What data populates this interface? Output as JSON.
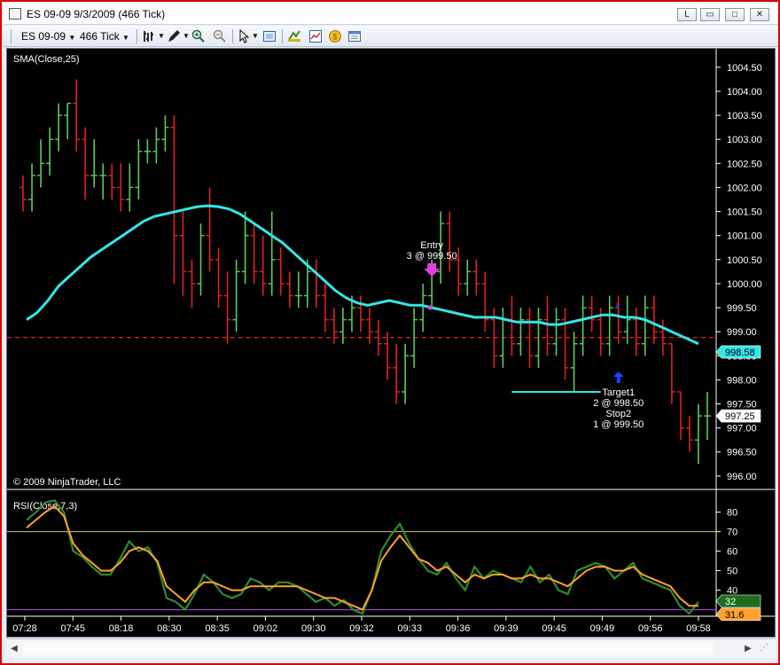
{
  "window": {
    "title": "ES 09-09  9/3/2009 (466 Tick)",
    "buttons": [
      "L",
      "▭",
      "□",
      "✕"
    ]
  },
  "toolbar": {
    "instrument": "ES 09-09",
    "interval": "466 Tick",
    "icons": [
      "bar-style-icon",
      "draw-pencil-icon",
      "zoom-in-icon",
      "zoom-out-icon",
      "cursor-icon",
      "properties-icon",
      "strategy-icon",
      "indicator-icon",
      "coin-icon",
      "data-box-icon"
    ]
  },
  "colors": {
    "background": "#000000",
    "up_bar": "#5ec95e",
    "down_bar": "#e02020",
    "sma": "#34e6e6",
    "rsi_main": "#2e8b2e",
    "rsi_avg": "#ffa12a",
    "price_line": "#e02020",
    "upper_band": "#c8c880",
    "lower_band": "#9040c0"
  },
  "chart_data": {
    "type": "candlestick",
    "instrument": "ES 09-09",
    "indicator_label": "SMA(Close,25)",
    "copyright": "© 2009 NinjaTrader, LLC",
    "price_ticks": [
      "1004.50",
      "1004.00",
      "1003.50",
      "1003.00",
      "1002.50",
      "1002.00",
      "1001.50",
      "1001.00",
      "1000.50",
      "1000.00",
      "999.50",
      "999.00",
      "998.50",
      "998.00",
      "997.50",
      "997.00",
      "996.50",
      "996.00"
    ],
    "price_ylim": [
      995.85,
      1004.7
    ],
    "time_labels": [
      "07:28",
      "07:45",
      "08:18",
      "08:30",
      "08:35",
      "09:02",
      "09:30",
      "09:32",
      "09:33",
      "09:36",
      "09:39",
      "09:45",
      "09:49",
      "09:56",
      "09:58"
    ],
    "current_price_tag": "997.25",
    "current_price": 997.25,
    "ask_tag": "998.58",
    "ask_price": 998.58,
    "bars": [
      [
        1002.0,
        1002.25,
        1001.5,
        1001.75
      ],
      [
        1001.75,
        1002.5,
        1001.5,
        1002.25
      ],
      [
        1002.25,
        1003.0,
        1002.0,
        1002.5
      ],
      [
        1002.5,
        1003.25,
        1002.25,
        1003.0
      ],
      [
        1003.0,
        1003.75,
        1002.75,
        1003.5
      ],
      [
        1003.5,
        1003.75,
        1003.0,
        1003.75
      ],
      [
        1003.75,
        1004.25,
        1002.75,
        1003.0
      ],
      [
        1003.0,
        1003.25,
        1001.75,
        1002.25
      ],
      [
        1002.25,
        1003.0,
        1002.0,
        1002.25
      ],
      [
        1002.25,
        1002.5,
        1001.75,
        1002.25
      ],
      [
        1002.25,
        1002.5,
        1001.75,
        1002.0
      ],
      [
        1002.0,
        1002.5,
        1001.5,
        1001.75
      ],
      [
        1001.75,
        1002.5,
        1001.5,
        1002.0
      ],
      [
        1002.0,
        1003.0,
        1001.75,
        1002.75
      ],
      [
        1002.75,
        1003.0,
        1002.5,
        1002.75
      ],
      [
        1002.75,
        1003.25,
        1002.5,
        1003.0
      ],
      [
        1003.0,
        1003.5,
        1002.75,
        1003.25
      ],
      [
        1003.25,
        1003.5,
        1000.0,
        1001.0
      ],
      [
        1001.0,
        1001.5,
        999.75,
        1000.25
      ],
      [
        1000.25,
        1000.5,
        999.5,
        1000.0
      ],
      [
        1000.0,
        1001.25,
        999.75,
        1001.0
      ],
      [
        1001.0,
        1002.0,
        1000.25,
        1000.5
      ],
      [
        1000.5,
        1000.75,
        999.5,
        999.75
      ],
      [
        999.75,
        1000.25,
        998.75,
        999.25
      ],
      [
        999.25,
        1000.5,
        999.0,
        1000.25
      ],
      [
        1000.25,
        1001.5,
        1000.0,
        1001.0
      ],
      [
        1001.0,
        1001.25,
        1000.0,
        1000.25
      ],
      [
        1000.25,
        1001.0,
        999.75,
        1000.0
      ],
      [
        1000.0,
        1001.5,
        999.75,
        1000.5
      ],
      [
        1000.5,
        1000.75,
        999.75,
        1000.0
      ],
      [
        1000.0,
        1000.25,
        999.5,
        999.75
      ],
      [
        999.75,
        1000.25,
        999.5,
        999.75
      ],
      [
        999.75,
        1000.5,
        999.5,
        1000.25
      ],
      [
        1000.25,
        1000.5,
        999.5,
        999.75
      ],
      [
        999.75,
        1000.0,
        999.0,
        999.25
      ],
      [
        999.25,
        999.5,
        998.75,
        999.0
      ],
      [
        999.0,
        999.5,
        998.75,
        999.25
      ],
      [
        999.25,
        999.75,
        999.0,
        999.5
      ],
      [
        999.5,
        999.75,
        999.0,
        999.25
      ],
      [
        999.25,
        999.5,
        998.75,
        999.0
      ],
      [
        999.0,
        999.25,
        998.5,
        998.75
      ],
      [
        998.75,
        999.0,
        998.0,
        998.25
      ],
      [
        998.25,
        998.75,
        997.5,
        997.75
      ],
      [
        997.75,
        998.75,
        997.5,
        998.5
      ],
      [
        998.5,
        999.5,
        998.25,
        999.25
      ],
      [
        999.25,
        1000.0,
        999.0,
        999.75
      ],
      [
        999.75,
        1000.5,
        999.5,
        1000.25
      ],
      [
        1000.25,
        1001.5,
        1000.0,
        1001.25
      ],
      [
        1001.25,
        1001.5,
        1000.25,
        1000.5
      ],
      [
        1000.5,
        1000.75,
        999.75,
        1000.0
      ],
      [
        1000.0,
        1000.5,
        999.75,
        1000.25
      ],
      [
        1000.25,
        1000.5,
        999.75,
        1000.0
      ],
      [
        1000.0,
        1000.25,
        999.0,
        999.25
      ],
      [
        999.25,
        999.5,
        998.25,
        998.5
      ],
      [
        998.5,
        999.5,
        998.25,
        999.25
      ],
      [
        999.25,
        999.75,
        998.5,
        998.75
      ],
      [
        998.75,
        999.5,
        998.5,
        999.25
      ],
      [
        999.25,
        999.5,
        998.25,
        998.5
      ],
      [
        998.5,
        999.5,
        998.25,
        999.25
      ],
      [
        999.25,
        999.75,
        998.5,
        998.75
      ],
      [
        998.75,
        999.5,
        998.5,
        999.25
      ],
      [
        999.25,
        999.5,
        998.0,
        998.25
      ],
      [
        998.25,
        999.0,
        997.75,
        998.75
      ],
      [
        998.75,
        999.75,
        998.5,
        999.5
      ],
      [
        999.5,
        999.75,
        999.0,
        999.25
      ],
      [
        999.25,
        999.5,
        998.5,
        998.75
      ],
      [
        998.75,
        999.75,
        998.5,
        999.5
      ],
      [
        999.5,
        999.75,
        998.75,
        999.0
      ],
      [
        999.0,
        999.75,
        998.75,
        999.25
      ],
      [
        999.25,
        999.5,
        998.5,
        998.75
      ],
      [
        998.75,
        999.75,
        998.5,
        999.5
      ],
      [
        999.5,
        999.75,
        998.75,
        999.0
      ],
      [
        999.0,
        999.25,
        998.5,
        998.75
      ],
      [
        998.75,
        998.75,
        997.5,
        997.75
      ],
      [
        997.75,
        997.75,
        996.75,
        997.0
      ],
      [
        997.0,
        997.25,
        996.5,
        996.75
      ],
      [
        996.75,
        997.5,
        996.25,
        997.25
      ],
      [
        997.25,
        997.75,
        996.75,
        997.25
      ]
    ],
    "sma": [
      999.25,
      999.4,
      999.65,
      999.95,
      1000.15,
      1000.35,
      1000.55,
      1000.7,
      1000.85,
      1001.0,
      1001.15,
      1001.3,
      1001.4,
      1001.45,
      1001.5,
      1001.55,
      1001.6,
      1001.62,
      1001.6,
      1001.55,
      1001.45,
      1001.3,
      1001.15,
      1001.0,
      1000.85,
      1000.65,
      1000.45,
      1000.25,
      1000.05,
      999.85,
      999.7,
      999.6,
      999.55,
      999.6,
      999.65,
      999.6,
      999.55,
      999.55,
      999.5,
      999.45,
      999.4,
      999.35,
      999.3,
      999.3,
      999.3,
      999.25,
      999.2,
      999.2,
      999.2,
      999.15,
      999.15,
      999.2,
      999.25,
      999.3,
      999.35,
      999.35,
      999.3,
      999.3,
      999.25,
      999.15,
      999.05,
      998.95,
      998.85,
      998.75
    ],
    "entry_marker": {
      "label": "Entry",
      "detail": "3 @ 999.50",
      "bar": 46,
      "price": 999.5
    },
    "exit_marker": {
      "label1": "Target1",
      "detail1": "2 @ 998.50",
      "label2": "Stop2",
      "detail2": "1 @ 999.50",
      "bar": 67,
      "price": 998.5
    },
    "horizontal_line": {
      "price": 998.88
    },
    "cyan_segment": {
      "from_bar": 55,
      "to_bar": 65,
      "price": 997.75
    },
    "rsi": {
      "label": "RSI(Close,7,3)",
      "ticks": [
        "80",
        "70",
        "60",
        "50",
        "40"
      ],
      "ylim": [
        28,
        88
      ],
      "upper_band": 70,
      "lower_band": 30,
      "current_tag_main": "32",
      "current_tag_avg": "31.6",
      "main": [
        76,
        80,
        85,
        86,
        80,
        60,
        57,
        52,
        48,
        48,
        56,
        65,
        60,
        62,
        54,
        36,
        34,
        30,
        38,
        48,
        44,
        38,
        36,
        38,
        46,
        44,
        40,
        44,
        44,
        42,
        38,
        34,
        36,
        32,
        35,
        30,
        28,
        40,
        60,
        68,
        74,
        64,
        56,
        50,
        48,
        54,
        46,
        40,
        52,
        46,
        50,
        48,
        46,
        44,
        52,
        44,
        48,
        40,
        38,
        50,
        52,
        54,
        52,
        46,
        50,
        54,
        46,
        44,
        42,
        40,
        32,
        28,
        34
      ],
      "avg": [
        72,
        76,
        80,
        83,
        78,
        64,
        58,
        54,
        50,
        50,
        54,
        60,
        62,
        60,
        55,
        42,
        38,
        34,
        40,
        44,
        44,
        42,
        40,
        40,
        42,
        42,
        42,
        42,
        42,
        42,
        40,
        38,
        36,
        36,
        34,
        32,
        30,
        40,
        55,
        62,
        68,
        62,
        56,
        54,
        50,
        52,
        48,
        44,
        48,
        46,
        48,
        48,
        46,
        46,
        48,
        46,
        46,
        44,
        42,
        46,
        50,
        52,
        52,
        50,
        50,
        52,
        48,
        46,
        44,
        42,
        36,
        32,
        32
      ]
    }
  }
}
